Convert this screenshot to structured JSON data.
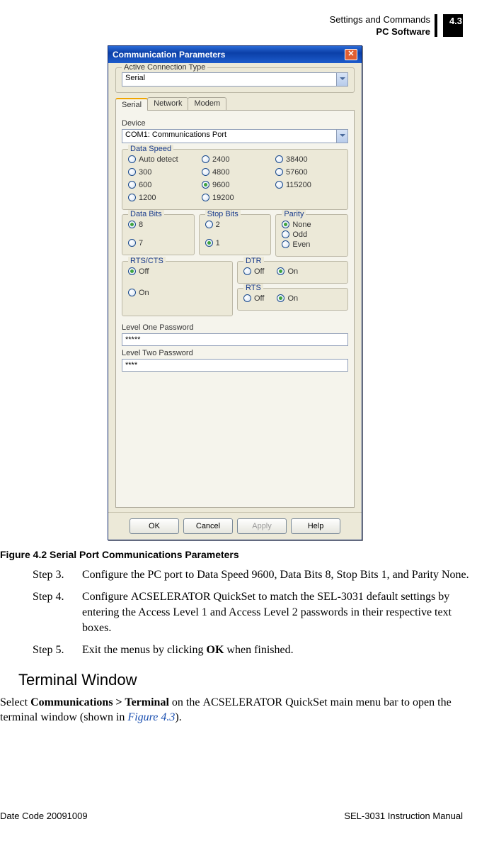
{
  "header": {
    "title": "Settings and Commands",
    "subtitle": "PC Software",
    "page_num": "4.3"
  },
  "dialog": {
    "title": "Communication Parameters",
    "conn_type_group": "Active Connection Type",
    "conn_type_value": "Serial",
    "tabs": {
      "serial": "Serial",
      "network": "Network",
      "modem": "Modem"
    },
    "device_label": "Device",
    "device_value": "COM1: Communications Port",
    "data_speed": {
      "title": "Data Speed",
      "opts": [
        "Auto detect",
        "300",
        "600",
        "1200",
        "2400",
        "4800",
        "9600",
        "19200",
        "38400",
        "57600",
        "115200"
      ],
      "selected": "9600"
    },
    "data_bits": {
      "title": "Data Bits",
      "opts": [
        "8",
        "7"
      ],
      "selected": "8"
    },
    "stop_bits": {
      "title": "Stop Bits",
      "opts": [
        "2",
        "1"
      ],
      "selected": "1"
    },
    "parity": {
      "title": "Parity",
      "opts": [
        "None",
        "Odd",
        "Even"
      ],
      "selected": "None"
    },
    "rtscts": {
      "title": "RTS/CTS",
      "opts": [
        "Off",
        "On"
      ],
      "selected": "Off"
    },
    "dtr": {
      "title": "DTR",
      "opts": [
        "Off",
        "On"
      ],
      "selected": "On"
    },
    "rts": {
      "title": "RTS",
      "opts": [
        "Off",
        "On"
      ],
      "selected": "On"
    },
    "lvl1_label": "Level One Password",
    "lvl1_value": "*****",
    "lvl2_label": "Level Two Password",
    "lvl2_value": "****",
    "buttons": {
      "ok": "OK",
      "cancel": "Cancel",
      "apply": "Apply",
      "help": "Help"
    }
  },
  "figure_caption": "Figure 4.2    Serial Port Communications Parameters",
  "steps": {
    "s3_label": "Step 3.",
    "s3": "Configure the PC port to Data Speed 9600, Data Bits 8, Stop Bits 1, and Parity None.",
    "s4_label": "Step 4.",
    "s4_a": "Configure ",
    "s4_sc": "acSELerator",
    "s4_b": " QuickSet to match the SEL-3031 default settings by entering the Access Level 1 and Access Level 2 passwords in their respective text boxes.",
    "s5_label": "Step 5.",
    "s5_a": "Exit the menus by clicking ",
    "s5_bold": "OK",
    "s5_b": " when finished."
  },
  "section_heading": "Terminal Window",
  "para": {
    "a": "Select ",
    "bold1": "Communications > Terminal",
    "b": " on the ",
    "sc": "acSELerator",
    "c": " QuickSet main menu bar to open the terminal window (shown in ",
    "ref": "Figure 4.3",
    "d": ")."
  },
  "footer": {
    "left": "Date Code 20091009",
    "right": "SEL-3031 Instruction Manual"
  }
}
